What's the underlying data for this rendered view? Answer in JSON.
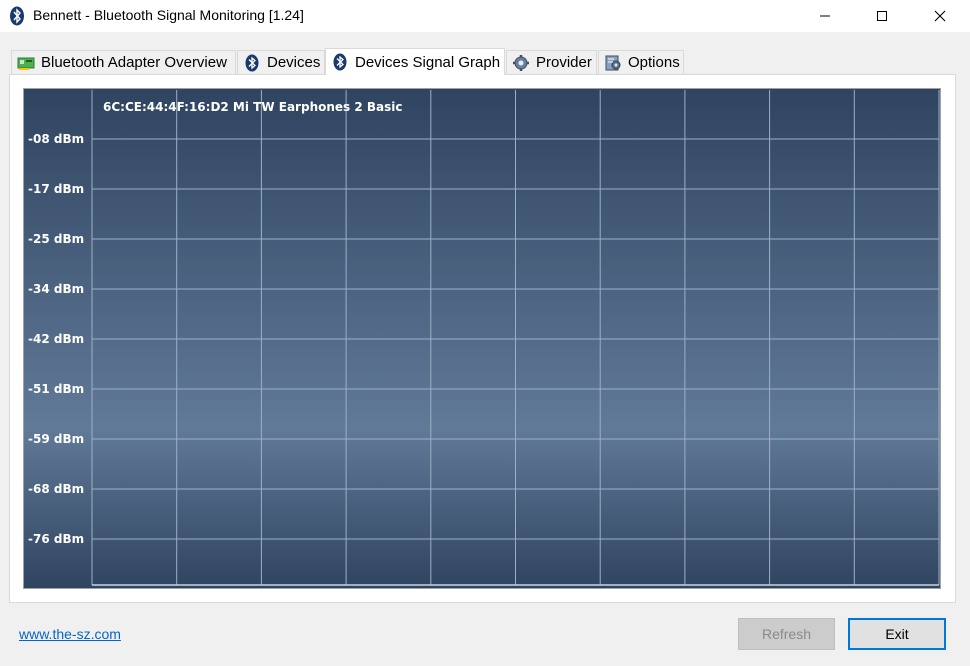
{
  "window": {
    "title": "Bennett - Bluetooth Signal Monitoring [1.24]"
  },
  "tabs": [
    {
      "label": "Bluetooth Adapter Overview",
      "icon": "adapter-card-icon",
      "active": false
    },
    {
      "label": "Devices",
      "icon": "bluetooth-icon",
      "active": false
    },
    {
      "label": "Devices Signal Graph",
      "icon": "bluetooth-icon",
      "active": true
    },
    {
      "label": "Provider",
      "icon": "gear-icon",
      "active": false
    },
    {
      "label": "Options",
      "icon": "options-icon",
      "active": false
    }
  ],
  "graph": {
    "device_label": "6C:CE:44:4F:16:D2 Mi TW Earphones 2 Basic",
    "y_ticks": [
      "-08 dBm",
      "-17 dBm",
      "-25 dBm",
      "-34 dBm",
      "-42 dBm",
      "-51 dBm",
      "-59 dBm",
      "-68 dBm",
      "-76 dBm"
    ],
    "vertical_grid_divisions": 10,
    "colors": {
      "top": "#2f4460",
      "middle": "#617a98",
      "bottom": "#2f4460",
      "grid": "#9eb0c6",
      "text": "#ffffff"
    }
  },
  "footer": {
    "link": "www.the-sz.com",
    "refresh_label": "Refresh",
    "exit_label": "Exit"
  }
}
